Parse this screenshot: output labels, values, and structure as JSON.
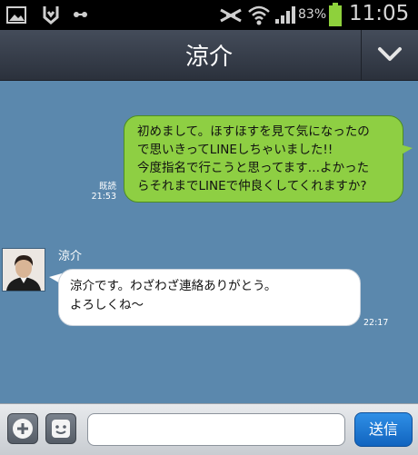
{
  "status": {
    "battery_percent": "83%",
    "time": "11:05"
  },
  "header": {
    "title": "涼介"
  },
  "messages": {
    "outgoing": {
      "text": "初めまして。ほすほすを見て気になったの\nで思いきってLINEしちゃいました!!\n今度指名で行こうと思ってます…よかった\nらそれまでLINEで仲良くしてくれますか?",
      "read_label": "既読",
      "time": "21:53"
    },
    "incoming": {
      "sender": "涼介",
      "text": "涼介です。わざわざ連絡ありがとう。\nよろしくね～",
      "time": "22:17"
    }
  },
  "input": {
    "value": "",
    "send_label": "送信"
  },
  "colors": {
    "chat_bg": "#5b88ad",
    "outgoing_bubble": "#8ecf43",
    "incoming_bubble": "#ffffff",
    "send_button": "#1f7ad6"
  }
}
